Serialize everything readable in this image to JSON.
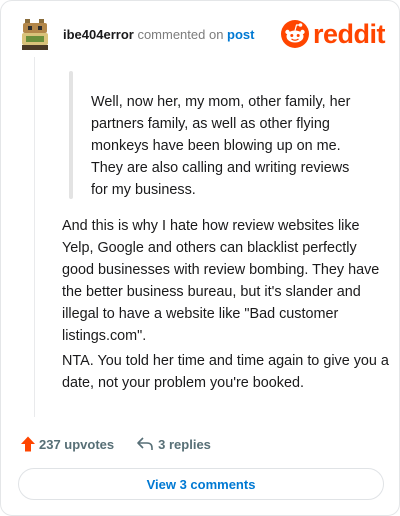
{
  "header": {
    "username": "ibe404error",
    "action_text": " commented on ",
    "post_link": "post",
    "logo_word": "reddit"
  },
  "quote": {
    "text": "Well, now her, my mom, other family, her partners family, as well as other flying monkeys have been blowing up on me. They are also calling and writing reviews for my business."
  },
  "body": {
    "paragraphs": [
      "And this is why I hate how review websites like Yelp, Google and others can blacklist perfectly good businesses with review bombing. They have the better business bureau, but it's slander and illegal to have a website like \"Bad customer listings.com\".",
      "NTA. You told her time and time again to give you a date, not your problem you're booked."
    ]
  },
  "actions": {
    "upvotes": "237 upvotes",
    "replies": "3 replies",
    "view_comments": "View 3 comments"
  },
  "colors": {
    "brand": "#ff4500",
    "link": "#0079d3",
    "muted": "#576f76"
  },
  "icons": {
    "avatar": "avatar-icon",
    "logo": "reddit-snoo-icon",
    "upvote": "upvote-arrow-icon",
    "reply": "reply-arrow-icon"
  }
}
